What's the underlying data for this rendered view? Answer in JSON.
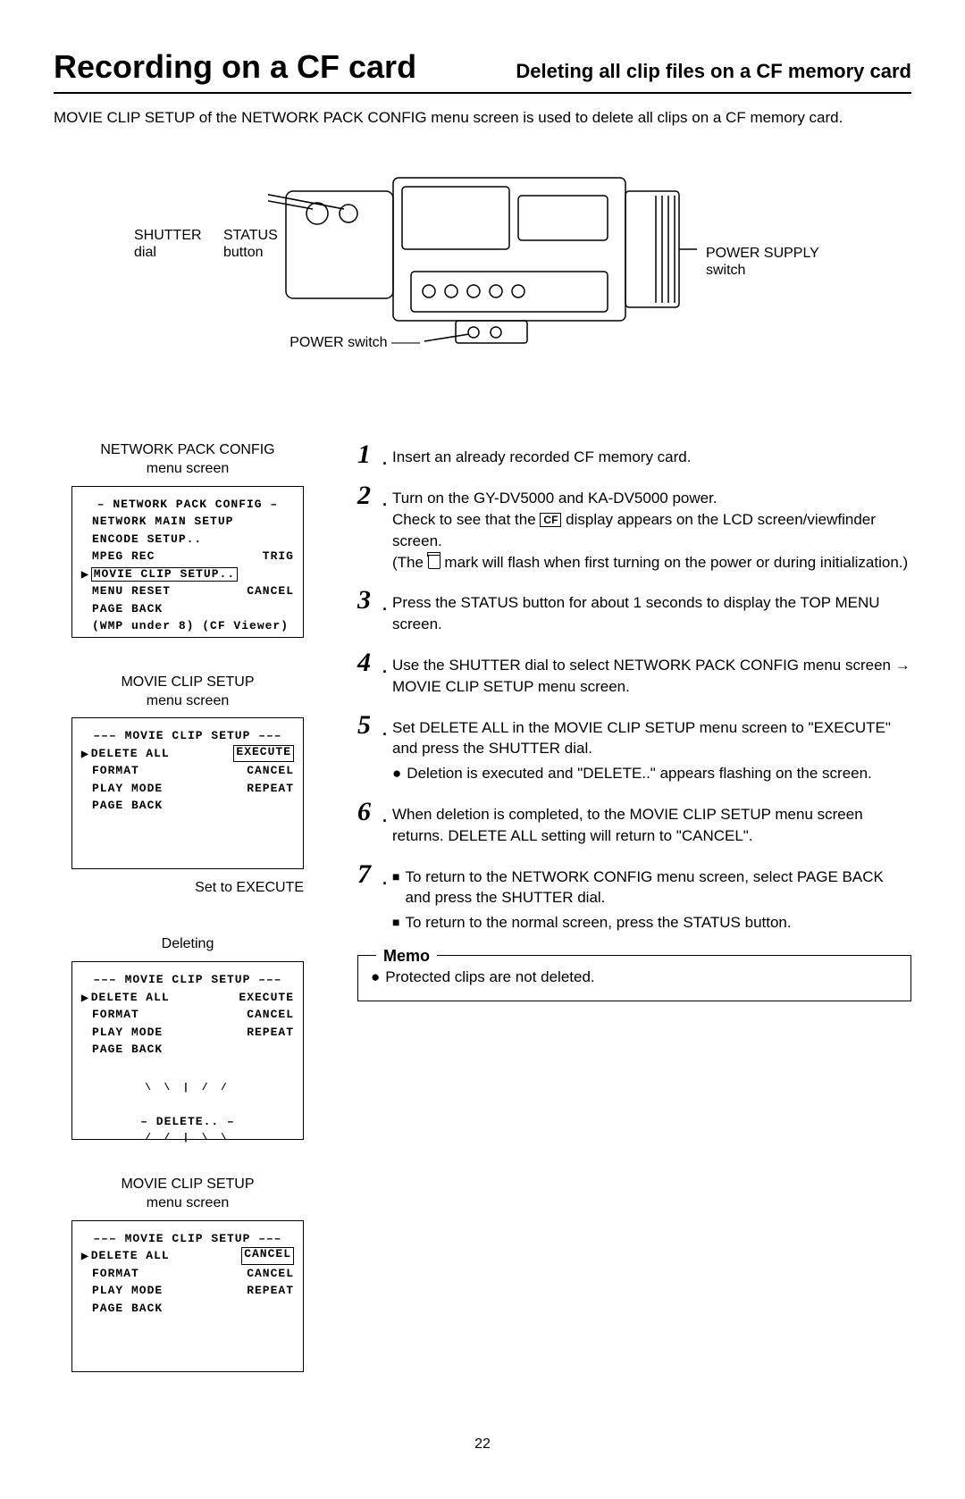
{
  "header": {
    "title": "Recording on a CF card",
    "subtitle": "Deleting all clip files on a CF memory card"
  },
  "intro": "MOVIE CLIP SETUP of the NETWORK PACK CONFIG menu screen is used to delete all clips on a CF memory card.",
  "diagram_labels": {
    "shutter_line1": "SHUTTER",
    "shutter_line2": "dial",
    "status_line1": "STATUS",
    "status_line2": "button",
    "power_switch": "POWER switch",
    "power_supply_line1": "POWER SUPPLY",
    "power_supply_line2": "switch"
  },
  "left": {
    "npc_caption_l1": "NETWORK PACK CONFIG",
    "npc_caption_l2": "menu screen",
    "npc_menu": {
      "title": "– NETWORK PACK CONFIG –",
      "l1": "NETWORK MAIN SETUP",
      "l2": "ENCODE SETUP..",
      "l3_l": "MPEG REC",
      "l3_r": "TRIG",
      "l4": "MOVIE CLIP SETUP..",
      "l5_l": "MENU RESET",
      "l5_r": "CANCEL",
      "l6": "PAGE BACK",
      "l7": "(WMP under 8) (CF Viewer)"
    },
    "mcs_caption_l1": "MOVIE CLIP SETUP",
    "mcs_caption_l2": "menu screen",
    "mcs_menu1": {
      "title": "––– MOVIE CLIP SETUP –––",
      "r1_l": "DELETE ALL",
      "r1_r": "EXECUTE",
      "r2_l": "FORMAT",
      "r2_r": "CANCEL",
      "r3_l": "PLAY MODE",
      "r3_r": "REPEAT",
      "r4_l": "PAGE BACK"
    },
    "set_execute": "Set to EXECUTE",
    "deleting": "Deleting",
    "mcs_menu2": {
      "title": "––– MOVIE CLIP SETUP –––",
      "r1_l": "DELETE ALL",
      "r1_r": "EXECUTE",
      "r2_l": "FORMAT",
      "r2_r": "CANCEL",
      "r3_l": "PLAY MODE",
      "r3_r": "REPEAT",
      "r4_l": "PAGE BACK",
      "delete_text": "DELETE.."
    },
    "mcs_caption2_l1": "MOVIE CLIP SETUP",
    "mcs_caption2_l2": "menu screen",
    "mcs_menu3": {
      "title": "––– MOVIE CLIP SETUP –––",
      "r1_l": "DELETE ALL",
      "r1_r": "CANCEL",
      "r2_l": "FORMAT",
      "r2_r": "CANCEL",
      "r3_l": "PLAY MODE",
      "r3_r": "REPEAT",
      "r4_l": "PAGE BACK"
    }
  },
  "steps": {
    "s1": "Insert an already recorded CF memory card.",
    "s2a": "Turn on the GY-DV5000 and KA-DV5000 power.",
    "s2b_pre": "Check to see that the ",
    "s2b_cf": "CF",
    "s2b_post": " display appears on the LCD screen/viewfinder screen.",
    "s2c_pre": "(The ",
    "s2c_post": " mark will flash when first turning on the power or during initialization.)",
    "s3": "Press the STATUS button for about 1 seconds to display the TOP MENU screen.",
    "s4": "Use the SHUTTER dial to select NETWORK PACK CONFIG menu screen → MOVIE CLIP SETUP menu screen.",
    "s5a": "Set DELETE ALL in the MOVIE CLIP SETUP menu screen to \"EXECUTE\" and press the SHUTTER dial.",
    "s5b": "Deletion is executed and \"DELETE..\" appears flashing on the screen.",
    "s6": "When deletion is completed, to the MOVIE CLIP SETUP menu screen returns. DELETE ALL setting will return to \"CANCEL\".",
    "s7a": "To return to the NETWORK CONFIG menu screen, select PAGE BACK and press the SHUTTER dial.",
    "s7b": "To return to the normal screen, press the STATUS button."
  },
  "memo": {
    "title": "Memo",
    "text": "Protected clips are not deleted."
  },
  "page_number": "22"
}
